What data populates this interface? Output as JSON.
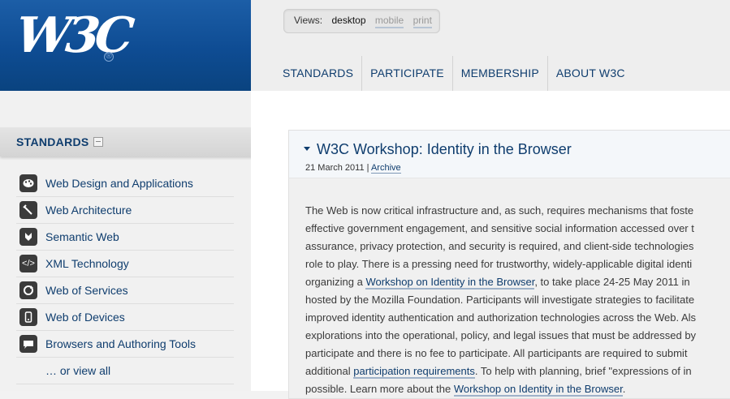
{
  "logo": {
    "text": "W3C",
    "reg": "®"
  },
  "views": {
    "label": "Views:",
    "current": "desktop",
    "options": [
      "mobile",
      "print"
    ]
  },
  "nav": [
    "STANDARDS",
    "PARTICIPATE",
    "MEMBERSHIP",
    "ABOUT W3C"
  ],
  "sidebar": {
    "title": "STANDARDS",
    "items": [
      {
        "label": "Web Design and Applications",
        "icon": "palette-icon"
      },
      {
        "label": "Web Architecture",
        "icon": "tools-icon"
      },
      {
        "label": "Semantic Web",
        "icon": "semantic-web-icon"
      },
      {
        "label": "XML Technology",
        "icon": "xml-icon"
      },
      {
        "label": "Web of Services",
        "icon": "services-icon"
      },
      {
        "label": "Web of Devices",
        "icon": "device-icon"
      },
      {
        "label": "Browsers and Authoring Tools",
        "icon": "browser-icon"
      }
    ],
    "view_all": "… or view all"
  },
  "article": {
    "title": "W3C Workshop: Identity in the Browser",
    "date": "21 March 2011",
    "separator": "|",
    "category": "Archive",
    "lines": [
      {
        "text": "The Web is now critical infrastructure and, as such, requires mechanisms that foste"
      },
      {
        "text": "effective government engagement, and sensitive social information accessed over t"
      },
      {
        "text": "assurance, privacy protection, and security is required, and client-side technologies"
      },
      {
        "text": "role to play. There is a pressing need for trustworthy, widely-applicable digital identi"
      },
      {
        "pre": "organizing a ",
        "link": "Workshop on Identity in the Browser",
        "post": ", to take place 24-25 May 2011 in"
      },
      {
        "text": "hosted by the Mozilla Foundation. Participants will investigate strategies to facilitate"
      },
      {
        "text": "improved identity authentication and authorization technologies across the Web. Als"
      },
      {
        "text": "explorations into the operational, policy, and legal issues that must be addressed by"
      },
      {
        "text": "participate and there is no fee to participate. All participants are required to submit"
      },
      {
        "pre": "additional ",
        "link": "participation requirements",
        "post": ". To help with planning, brief \"expressions of in"
      },
      {
        "pre": "possible. Learn more about the ",
        "link": "Workshop on Identity in the Browser",
        "post": "."
      }
    ]
  }
}
